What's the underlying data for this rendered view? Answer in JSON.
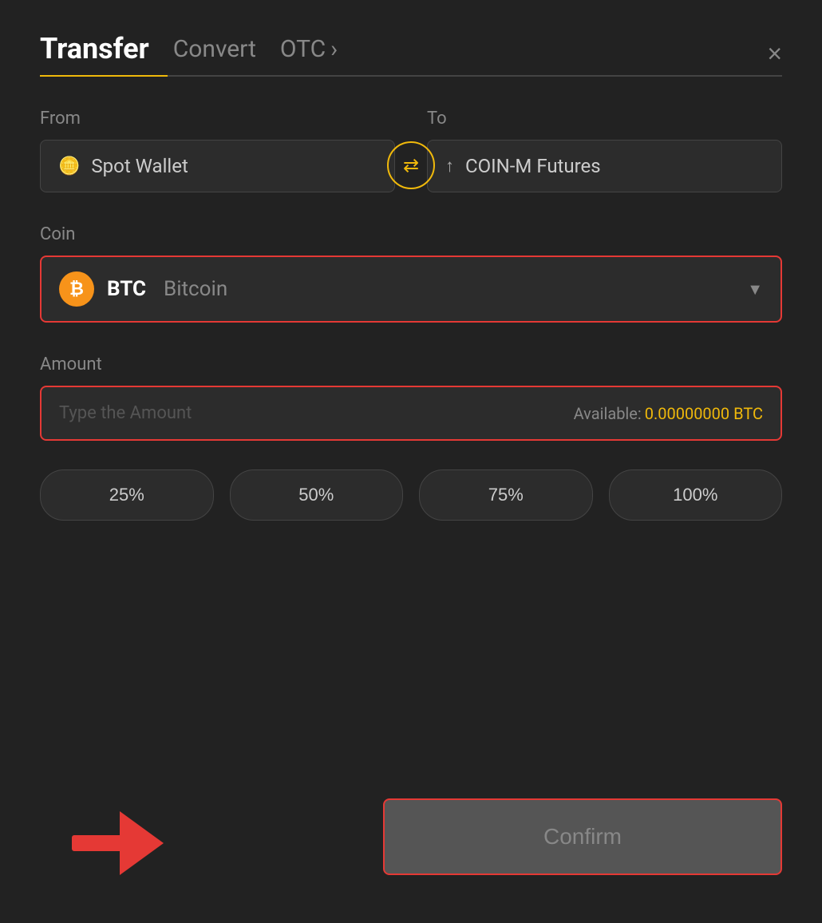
{
  "header": {
    "tab_transfer": "Transfer",
    "tab_convert": "Convert",
    "tab_otc": "OTC",
    "tab_otc_chevron": "›",
    "close_label": "×"
  },
  "from": {
    "label": "From",
    "wallet_icon": "▬",
    "wallet_name": "Spot Wallet"
  },
  "to": {
    "label": "To",
    "wallet_icon": "↑",
    "wallet_name": "COIN-M Futures"
  },
  "swap": {
    "arrows": "⇄"
  },
  "coin": {
    "label": "Coin",
    "symbol": "BTC",
    "name": "Bitcoin",
    "chevron": "▼"
  },
  "amount": {
    "label": "Amount",
    "placeholder": "Type the Amount",
    "available_label": "Available:",
    "available_value": "0.00000000 BTC"
  },
  "percentages": [
    {
      "label": "25%"
    },
    {
      "label": "50%"
    },
    {
      "label": "75%"
    },
    {
      "label": "100%"
    }
  ],
  "confirm": {
    "label": "Confirm"
  }
}
